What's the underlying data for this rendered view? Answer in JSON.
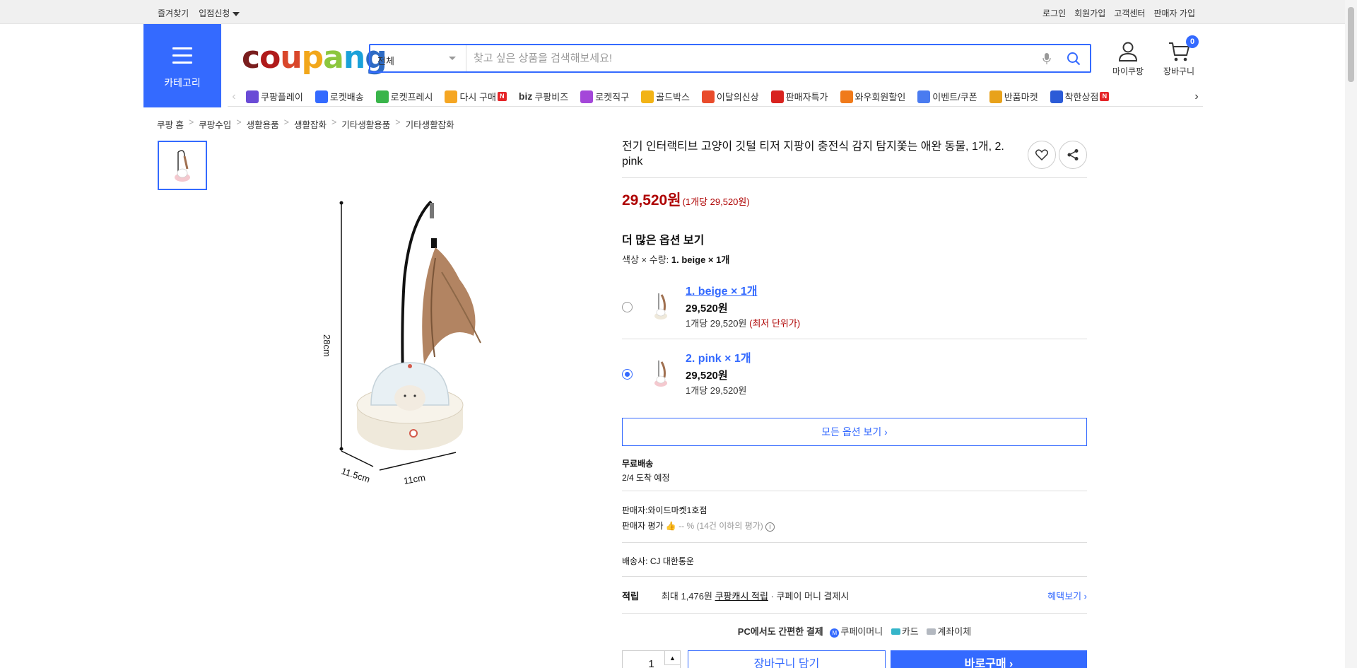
{
  "topbar": {
    "bookmark": "즐겨찾기",
    "store_apply": "입점신청",
    "login": "로그인",
    "signup": "회원가입",
    "customer_center": "고객센터",
    "seller_signup": "판매자 가입"
  },
  "header": {
    "category_label": "카테고리",
    "logo_parts": [
      "c",
      "o",
      "u",
      "p",
      "a",
      "n",
      "g"
    ],
    "search_category": "전체",
    "search_placeholder": "찾고 싶은 상품을 검색해보세요!",
    "mypage": "마이쿠팡",
    "cart": "장바구니",
    "cart_count": "0"
  },
  "nav": [
    {
      "label": "쿠팡플레이",
      "icon": "play-icon",
      "color": "#6a4bd6"
    },
    {
      "label": "로켓배송",
      "icon": "rocket-icon",
      "color": "#346aff"
    },
    {
      "label": "로켓프레시",
      "icon": "rocket-fresh-icon",
      "color": "#39b54a"
    },
    {
      "label": "다시 구매",
      "icon": "rebuy-icon",
      "color": "#f5a623",
      "badge": "N"
    },
    {
      "label": "쿠팡비즈",
      "icon": "biz-icon",
      "color": "#333",
      "prefix": "biz"
    },
    {
      "label": "로켓직구",
      "icon": "global-icon",
      "color": "#a447d9"
    },
    {
      "label": "골드박스",
      "icon": "goldbox-icon",
      "color": "#f2b316"
    },
    {
      "label": "이달의신상",
      "icon": "new-icon",
      "color": "#e94b2b"
    },
    {
      "label": "판매자특가",
      "icon": "sale-icon",
      "color": "#d8231f"
    },
    {
      "label": "와우회원할인",
      "icon": "wow-icon",
      "color": "#f07a1a"
    },
    {
      "label": "이벤트/쿠폰",
      "icon": "coupon-icon",
      "color": "#4a7bf0"
    },
    {
      "label": "반품마켓",
      "icon": "return-market-icon",
      "color": "#e8a21b"
    },
    {
      "label": "착한상점",
      "icon": "store-icon",
      "color": "#2b5bd7",
      "badge": "N"
    }
  ],
  "breadcrumb": [
    "쿠팡 홈",
    "쿠팡수입",
    "생활용품",
    "생활잡화",
    "기타생활용품",
    "기타생활잡화"
  ],
  "product": {
    "title": "전기 인터랙티브 고양이 깃털 티저 지팡이 충전식 감지 탐지쫓는 애완 동물, 1개, 2. pink",
    "price": "29,520원",
    "unit_price": "(1개당 29,520원)",
    "image_dims": {
      "height_label": "28cm",
      "depth_label": "11.5cm",
      "width_label": "11cm"
    }
  },
  "options": {
    "title": "더 많은 옵션 보기",
    "selection_prefix": "색상 × 수량:",
    "selection_value": "1. beige × 1개",
    "items": [
      {
        "name": "1. beige × 1개",
        "price": "29,520원",
        "unit": "1개당 29,520원",
        "tag": "(최저 단위가)",
        "selected": false
      },
      {
        "name": "2. pink × 1개",
        "price": "29,520원",
        "unit": "1개당 29,520원",
        "tag": "",
        "selected": true
      }
    ],
    "all_options": "모든 옵션 보기 ›"
  },
  "shipping": {
    "title": "무료배송",
    "eta": "2/4 도착 예정"
  },
  "seller": {
    "name_label": "판매자:",
    "name": "와이드마켓1호점",
    "rating_label": "판매자 평가",
    "rating_value": "-- %",
    "rating_note": "(14건 이하의 평가)"
  },
  "carrier": {
    "label": "배송사:",
    "name": "CJ 대한통운"
  },
  "reward": {
    "label": "적립",
    "amount": "최대 1,476원",
    "cash": "쿠팡캐시 적립",
    "note": "· 쿠페이 머니 결제시",
    "benefit_link": "혜택보기 ›"
  },
  "payment": {
    "title": "PC에서도 간편한 결제",
    "methods": [
      "쿠페이머니",
      "카드",
      "계좌이체"
    ]
  },
  "purchase": {
    "qty": "1",
    "cart_button": "장바구니 담기",
    "buy_button": "바로구매 ›"
  },
  "colors": {
    "accent": "#346aff",
    "price": "#ae0000"
  }
}
